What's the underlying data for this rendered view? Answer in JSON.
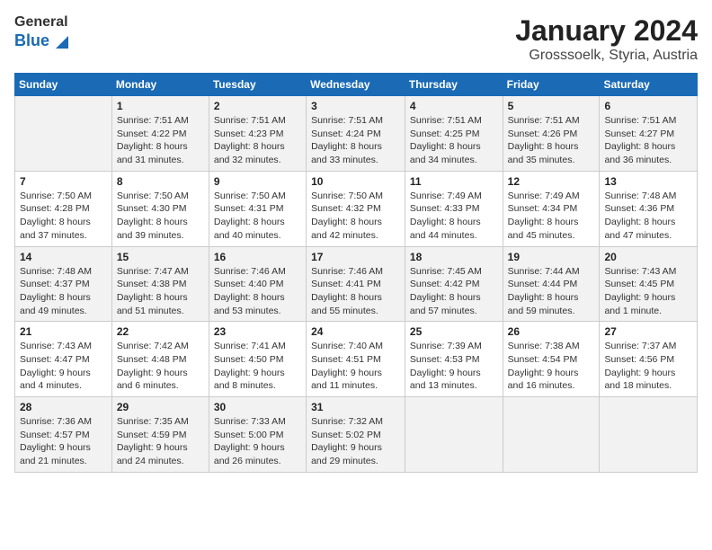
{
  "header": {
    "logo_general": "General",
    "logo_blue": "Blue",
    "title": "January 2024",
    "subtitle": "Grosssoelk, Styria, Austria"
  },
  "columns": [
    "Sunday",
    "Monday",
    "Tuesday",
    "Wednesday",
    "Thursday",
    "Friday",
    "Saturday"
  ],
  "weeks": [
    [
      {
        "day": "",
        "details": ""
      },
      {
        "day": "1",
        "details": "Sunrise: 7:51 AM\nSunset: 4:22 PM\nDaylight: 8 hours\nand 31 minutes."
      },
      {
        "day": "2",
        "details": "Sunrise: 7:51 AM\nSunset: 4:23 PM\nDaylight: 8 hours\nand 32 minutes."
      },
      {
        "day": "3",
        "details": "Sunrise: 7:51 AM\nSunset: 4:24 PM\nDaylight: 8 hours\nand 33 minutes."
      },
      {
        "day": "4",
        "details": "Sunrise: 7:51 AM\nSunset: 4:25 PM\nDaylight: 8 hours\nand 34 minutes."
      },
      {
        "day": "5",
        "details": "Sunrise: 7:51 AM\nSunset: 4:26 PM\nDaylight: 8 hours\nand 35 minutes."
      },
      {
        "day": "6",
        "details": "Sunrise: 7:51 AM\nSunset: 4:27 PM\nDaylight: 8 hours\nand 36 minutes."
      }
    ],
    [
      {
        "day": "7",
        "details": "Sunrise: 7:50 AM\nSunset: 4:28 PM\nDaylight: 8 hours\nand 37 minutes."
      },
      {
        "day": "8",
        "details": "Sunrise: 7:50 AM\nSunset: 4:30 PM\nDaylight: 8 hours\nand 39 minutes."
      },
      {
        "day": "9",
        "details": "Sunrise: 7:50 AM\nSunset: 4:31 PM\nDaylight: 8 hours\nand 40 minutes."
      },
      {
        "day": "10",
        "details": "Sunrise: 7:50 AM\nSunset: 4:32 PM\nDaylight: 8 hours\nand 42 minutes."
      },
      {
        "day": "11",
        "details": "Sunrise: 7:49 AM\nSunset: 4:33 PM\nDaylight: 8 hours\nand 44 minutes."
      },
      {
        "day": "12",
        "details": "Sunrise: 7:49 AM\nSunset: 4:34 PM\nDaylight: 8 hours\nand 45 minutes."
      },
      {
        "day": "13",
        "details": "Sunrise: 7:48 AM\nSunset: 4:36 PM\nDaylight: 8 hours\nand 47 minutes."
      }
    ],
    [
      {
        "day": "14",
        "details": "Sunrise: 7:48 AM\nSunset: 4:37 PM\nDaylight: 8 hours\nand 49 minutes."
      },
      {
        "day": "15",
        "details": "Sunrise: 7:47 AM\nSunset: 4:38 PM\nDaylight: 8 hours\nand 51 minutes."
      },
      {
        "day": "16",
        "details": "Sunrise: 7:46 AM\nSunset: 4:40 PM\nDaylight: 8 hours\nand 53 minutes."
      },
      {
        "day": "17",
        "details": "Sunrise: 7:46 AM\nSunset: 4:41 PM\nDaylight: 8 hours\nand 55 minutes."
      },
      {
        "day": "18",
        "details": "Sunrise: 7:45 AM\nSunset: 4:42 PM\nDaylight: 8 hours\nand 57 minutes."
      },
      {
        "day": "19",
        "details": "Sunrise: 7:44 AM\nSunset: 4:44 PM\nDaylight: 8 hours\nand 59 minutes."
      },
      {
        "day": "20",
        "details": "Sunrise: 7:43 AM\nSunset: 4:45 PM\nDaylight: 9 hours\nand 1 minute."
      }
    ],
    [
      {
        "day": "21",
        "details": "Sunrise: 7:43 AM\nSunset: 4:47 PM\nDaylight: 9 hours\nand 4 minutes."
      },
      {
        "day": "22",
        "details": "Sunrise: 7:42 AM\nSunset: 4:48 PM\nDaylight: 9 hours\nand 6 minutes."
      },
      {
        "day": "23",
        "details": "Sunrise: 7:41 AM\nSunset: 4:50 PM\nDaylight: 9 hours\nand 8 minutes."
      },
      {
        "day": "24",
        "details": "Sunrise: 7:40 AM\nSunset: 4:51 PM\nDaylight: 9 hours\nand 11 minutes."
      },
      {
        "day": "25",
        "details": "Sunrise: 7:39 AM\nSunset: 4:53 PM\nDaylight: 9 hours\nand 13 minutes."
      },
      {
        "day": "26",
        "details": "Sunrise: 7:38 AM\nSunset: 4:54 PM\nDaylight: 9 hours\nand 16 minutes."
      },
      {
        "day": "27",
        "details": "Sunrise: 7:37 AM\nSunset: 4:56 PM\nDaylight: 9 hours\nand 18 minutes."
      }
    ],
    [
      {
        "day": "28",
        "details": "Sunrise: 7:36 AM\nSunset: 4:57 PM\nDaylight: 9 hours\nand 21 minutes."
      },
      {
        "day": "29",
        "details": "Sunrise: 7:35 AM\nSunset: 4:59 PM\nDaylight: 9 hours\nand 24 minutes."
      },
      {
        "day": "30",
        "details": "Sunrise: 7:33 AM\nSunset: 5:00 PM\nDaylight: 9 hours\nand 26 minutes."
      },
      {
        "day": "31",
        "details": "Sunrise: 7:32 AM\nSunset: 5:02 PM\nDaylight: 9 hours\nand 29 minutes."
      },
      {
        "day": "",
        "details": ""
      },
      {
        "day": "",
        "details": ""
      },
      {
        "day": "",
        "details": ""
      }
    ]
  ]
}
